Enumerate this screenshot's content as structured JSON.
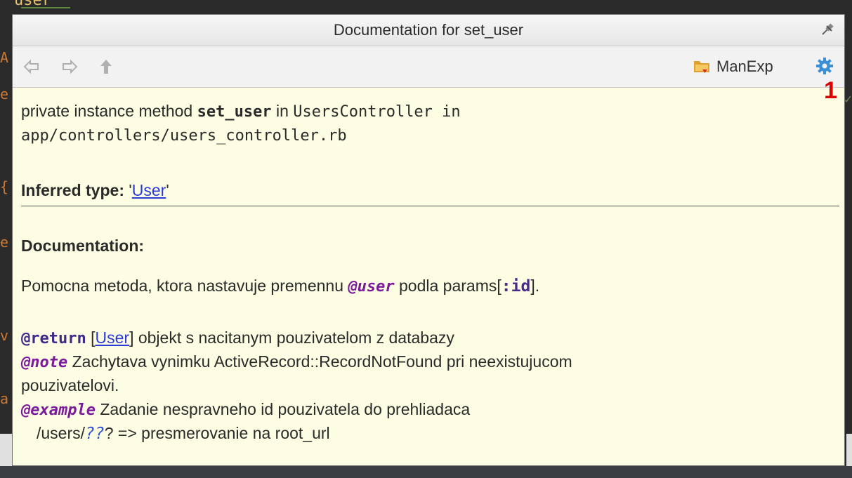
{
  "popup": {
    "title": "Documentation for set_user"
  },
  "toolbar": {
    "manexp_label": "ManExp"
  },
  "badge": "1",
  "doc": {
    "sig_prefix": "private instance method ",
    "sig_method": "set_user",
    "sig_in": " in ",
    "sig_class": "UsersController in",
    "sig_path": "app/controllers/users_controller.rb",
    "inferred_label": "Inferred type:",
    "inferred_quote_open": " '",
    "inferred_type": "User",
    "inferred_quote_close": "'",
    "documentation_label": "Documentation:",
    "desc_text": "Pomocna metoda, ktora nastavuje premennu ",
    "desc_ivar": "@user",
    "desc_after": " podla params[",
    "desc_symbol": ":id",
    "desc_end": "].",
    "return_tag": "@return",
    "return_bracket_open": " [",
    "return_type": "User",
    "return_text": "] objekt s nacitanym pouzivatelom z databazy",
    "note_tag": "@note",
    "note_text": " Zachytava vynimku ActiveRecord::RecordNotFound pri neexistujucom",
    "note_text_2": "pouzivatelovi.",
    "example_tag": "@example",
    "example_text": " Zadanie nespravneho id pouzivatela do prehliadaca",
    "example_code_prefix": "/users/",
    "example_code_q": "??",
    "example_code_suffix": "? => presmerovanie na root_url"
  },
  "editor": {
    "top_fragment": "user"
  },
  "colors": {
    "popup_bg": "#fdfde3",
    "link": "#2a3cd8",
    "tag": "#3f2a8a",
    "tag_italic": "#7b1a9a",
    "badge": "#e00000",
    "gear": "#3a8fd6"
  }
}
